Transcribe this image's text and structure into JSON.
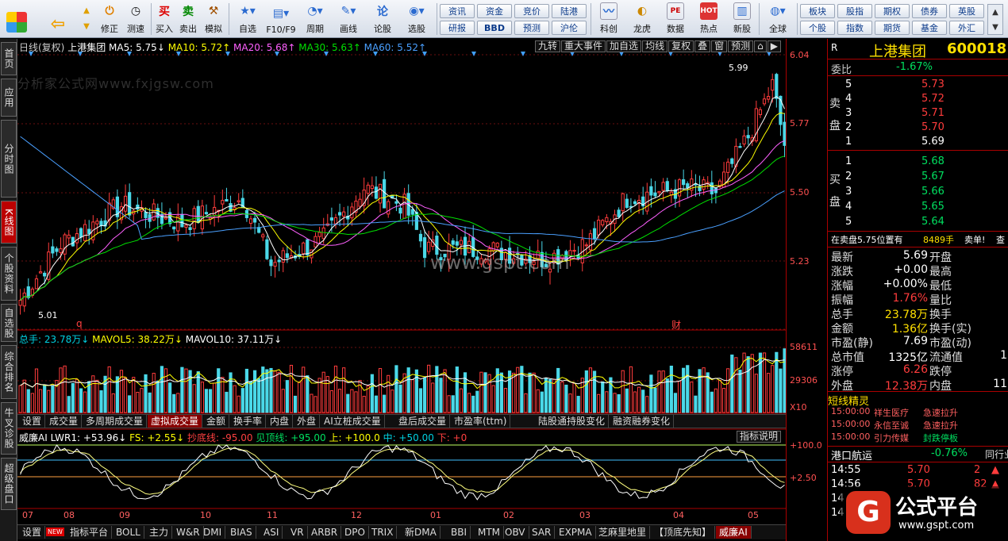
{
  "toolbar": {
    "buttons": [
      "修正",
      "测速",
      "买入",
      "卖出",
      "模拟",
      "自选",
      "F10/F9",
      "周期",
      "画线",
      "论股",
      "选股"
    ],
    "row_buttons": [
      [
        "资讯",
        "资金",
        "竞价",
        "陆港"
      ],
      [
        "研报",
        "BBD",
        "预测",
        "沪伦"
      ]
    ],
    "tools": [
      "科创",
      "龙虎",
      "数据",
      "热点",
      "新股"
    ],
    "right_buttons": [
      [
        "板块",
        "股指",
        "期权",
        "债券",
        "英股"
      ],
      [
        "个股",
        "指数",
        "期货",
        "基金",
        "外汇"
      ]
    ],
    "global_label": "全球"
  },
  "left_tabs": [
    "首页",
    "应用",
    "分时图",
    "K线图",
    "个股资料",
    "自选股",
    "综合排名",
    "牛叉诊股",
    "超级盘口"
  ],
  "chart": {
    "header": {
      "title": "日线(复权)",
      "name": "上港集团",
      "ma5": "MA5: 5.75↓",
      "ma10": "MA10: 5.72↑",
      "ma20": "MA20: 5.68↑",
      "ma30": "MA30: 5.63↑",
      "ma60": "MA60: 5.52↑"
    },
    "top_tools": [
      "九转",
      "重大事件",
      "加自选",
      "均线",
      "复权",
      "叠",
      "窗",
      "预测",
      "⌂",
      "▶"
    ],
    "price_axis": [
      "6.04",
      "5.77",
      "5.50",
      "5.23"
    ],
    "vol_axis": [
      "58611",
      "29306",
      "X10"
    ],
    "ind_axis": [
      "+100.0",
      "+2.50"
    ],
    "high_label": "5.99",
    "low_label": "5.01",
    "marker_q": "q",
    "marker_cai": "财",
    "watermark": "分析家公式网www.fxjgsw.com",
    "watermark2": "www.gspt.com",
    "volume_header": {
      "total": "总手: 23.78万↓",
      "mavol5": "MAVOL5: 38.22万↓",
      "mavol10": "MAVOL10: 37.11万↓"
    },
    "mid_tabs": [
      "设置",
      "成交量",
      "多周期成交量",
      "虚拟成交量",
      "金额",
      "换手率",
      "内盘",
      "外盘",
      "AI立桩成交量",
      "盘后成交量",
      "市盈率(ttm)",
      "陆股通持股变化",
      "融资融券变化"
    ],
    "mid_tab_active": 3,
    "indicator_header": {
      "name": "威廉AI",
      "lwr1": "LWR1: +53.96↓",
      "fs": "FS: +2.55↓",
      "bottom": "抄底线: -95.00",
      "top": "见顶线: +95.00",
      "up": "上: +100.0",
      "mid": "中: +50.00",
      "down": "下: +0",
      "explain": "指标说明"
    },
    "months": [
      "07",
      "08",
      "09",
      "10",
      "11",
      "12",
      "01",
      "02",
      "03",
      "04",
      "05"
    ],
    "bottom_tabs": [
      "设置",
      "指标平台",
      "BOLL",
      "主力",
      "W&R",
      "DMI",
      "BIAS",
      "ASI",
      "VR",
      "ARBR",
      "DPO",
      "TRIX",
      "新DMA",
      "BBI",
      "MTM",
      "OBV",
      "SAR",
      "EXPMA",
      "芝麻里地里",
      "【顶底先知】",
      "威廉AI"
    ],
    "bottom_new_badge": "NEW"
  },
  "panel": {
    "code_label": "R",
    "stock_name": "上港集团",
    "stock_code": "600018",
    "weibi_label": "委比",
    "weibi": "-1.67%",
    "sell_label": "卖盘",
    "buy_label": "买盘",
    "sells": [
      [
        "5",
        "5.73"
      ],
      [
        "4",
        "5.72"
      ],
      [
        "3",
        "5.71"
      ],
      [
        "2",
        "5.70"
      ],
      [
        "1",
        "5.69"
      ]
    ],
    "buys": [
      [
        "1",
        "5.68"
      ],
      [
        "2",
        "5.67"
      ],
      [
        "3",
        "5.66"
      ],
      [
        "4",
        "5.65"
      ],
      [
        "5",
        "5.64"
      ]
    ],
    "status": "在卖盘5.75位置有",
    "status_vol": "8489手",
    "status_btn": "卖单!",
    "status_btn2": "查",
    "stats_left": [
      [
        "最新",
        "5.69"
      ],
      [
        "涨跌",
        "+0.00"
      ],
      [
        "涨幅",
        "+0.00%"
      ],
      [
        "振幅",
        "1.76%"
      ],
      [
        "总手",
        "23.78万"
      ],
      [
        "金额",
        "1.36亿"
      ],
      [
        "市盈(静)",
        "7.69"
      ],
      [
        "总市值",
        "1325亿"
      ],
      [
        "涨停",
        "6.26"
      ],
      [
        "外盘",
        "12.38万"
      ]
    ],
    "stats_right": [
      "开盘",
      "最高",
      "最低",
      "量比",
      "换手",
      "换手(实)",
      "市盈(动)",
      "流通值",
      "跌停",
      "内盘"
    ],
    "stats_right_vals": [
      "",
      "",
      "",
      "",
      "",
      "",
      "",
      "1",
      "",
      "11"
    ],
    "short_title": "短线精灵",
    "short_items": [
      [
        "15:00:00",
        "祥生医疗",
        "急速拉升"
      ],
      [
        "15:00:00",
        "永信至诚",
        "急速拉升"
      ],
      [
        "15:00:00",
        "引力传媒",
        "封跌停板"
      ]
    ],
    "port_name": "港口航运",
    "port_change": "-0.76%",
    "port_tab": "同行业",
    "trades": [
      [
        "14:55",
        "5.70",
        "2"
      ],
      [
        "14:56",
        "5.70",
        "82"
      ],
      [
        "14",
        "",
        " "
      ],
      [
        "14",
        "",
        " "
      ]
    ],
    "logo_text": "公式平台",
    "logo_url": "www.gspt.com"
  },
  "colors": {
    "up": "#ff3c3c",
    "down": "#4ad8e8",
    "ma5": "#ffffff",
    "ma10": "#ffff00",
    "ma20": "#ff60ff",
    "ma30": "#00e000",
    "ma60": "#4aa0ff",
    "vol_up": "#ff3c3c",
    "vol_down": "#4ad8e8",
    "accent": "#b00000"
  }
}
